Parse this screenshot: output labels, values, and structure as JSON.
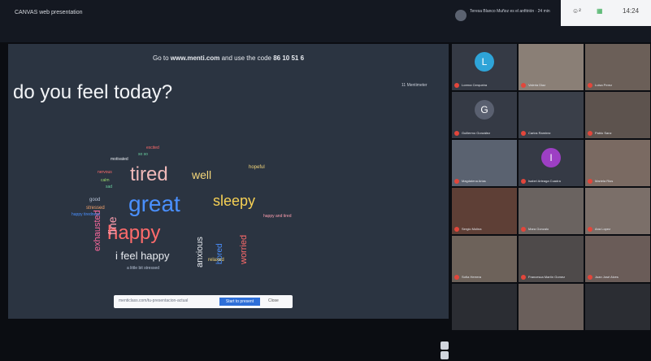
{
  "window": {
    "title": "CANVAS web presentation"
  },
  "host": {
    "label": "Teresa Blanco Muñoz es el anfitrión · 24 min"
  },
  "controls": {
    "participants": "☺²",
    "grid": "▦",
    "time": "14:24"
  },
  "slide": {
    "instruction_prefix": "Go to ",
    "instruction_site": "www.menti.com",
    "instruction_mid": " and use the code ",
    "instruction_code": "86 10 51 6",
    "question": "do you feel today?",
    "votes": "11 Mentimeter",
    "share_bar": {
      "input": "menticlass.com/tu-presentacion-actual",
      "button": "Start to present",
      "close": "Close"
    }
  },
  "words": [
    {
      "text": "great",
      "color": "#4a90ff"
    },
    {
      "text": "tired",
      "color": "#f0b9b9"
    },
    {
      "text": "happy",
      "color": "#ff6b6b"
    },
    {
      "text": "sleepy",
      "color": "#f7d154"
    },
    {
      "text": "well",
      "color": "#f5d77a"
    },
    {
      "text": "i feel happy",
      "color": "#e8ebf0"
    },
    {
      "text": "fine",
      "color": "#ff9fb0"
    },
    {
      "text": "exhausted",
      "color": "#ff6aa0"
    },
    {
      "text": "anxious",
      "color": "#e8ebf0"
    },
    {
      "text": "bored",
      "color": "#4a90ff"
    },
    {
      "text": "worried",
      "color": "#ff6b6b"
    },
    {
      "text": "relaxed",
      "color": "#f5d77a"
    },
    {
      "text": "happy and tired",
      "color": "#ff9fb0"
    },
    {
      "text": "good",
      "color": "#b7c3d6"
    },
    {
      "text": "stressed",
      "color": "#f5a36a"
    },
    {
      "text": "sad",
      "color": "#6ad0a0"
    },
    {
      "text": "calm",
      "color": "#9bd86b"
    },
    {
      "text": "motivated",
      "color": "#e8ebf0"
    },
    {
      "text": "excited",
      "color": "#ff6b6b"
    },
    {
      "text": "so so",
      "color": "#6ad0a0"
    },
    {
      "text": "a little bit stressed",
      "color": "#b7c3d6"
    },
    {
      "text": "happy tiredness",
      "color": "#4a90ff"
    },
    {
      "text": "nervous",
      "color": "#ff6b6b"
    },
    {
      "text": "hopeful",
      "color": "#f5d77a"
    }
  ],
  "participants": [
    {
      "name": "Lorena Cerqueira",
      "initial": "L",
      "bg": "#353a45",
      "avatar": "#2ea4d8"
    },
    {
      "name": "Valeria Diaz",
      "initial": "",
      "bg": "#8a7f76",
      "avatar": ""
    },
    {
      "name": "Luisa Perez",
      "initial": "",
      "bg": "#6b5f58",
      "avatar": ""
    },
    {
      "name": "Guillermo González",
      "initial": "G",
      "bg": "#353a45",
      "avatar": "#5a6070"
    },
    {
      "name": "Carlos Ramirez",
      "initial": "",
      "bg": "#3a3f49",
      "avatar": ""
    },
    {
      "name": "Pablo Sanz",
      "initial": "",
      "bg": "#5d534e",
      "avatar": ""
    },
    {
      "name": "Magdalena Arias",
      "initial": "",
      "bg": "#5a6270",
      "avatar": ""
    },
    {
      "name": "Isabel Arteaga Cuadra",
      "initial": "I",
      "bg": "#353a45",
      "avatar": "#9d3fc4"
    },
    {
      "name": "Mariela Rios",
      "initial": "",
      "bg": "#7a6a62",
      "avatar": ""
    },
    {
      "name": "Sergio Molina",
      "initial": "",
      "bg": "#5e3f36",
      "avatar": ""
    },
    {
      "name": "Mara Gonzalo",
      "initial": "",
      "bg": "#6a6360",
      "avatar": ""
    },
    {
      "name": "Ana Lopez",
      "initial": "",
      "bg": "#7b6f69",
      "avatar": ""
    },
    {
      "name": "Sofía Herrera",
      "initial": "",
      "bg": "#6d625a",
      "avatar": ""
    },
    {
      "name": "Francesca Martín Gomez",
      "initial": "",
      "bg": "#4e4a4a",
      "avatar": ""
    },
    {
      "name": "Juan José Alves",
      "initial": "",
      "bg": "#6a5c58",
      "avatar": ""
    },
    {
      "name": "",
      "initial": "",
      "bg": "#2b2d33",
      "avatar": ""
    },
    {
      "name": "",
      "initial": "",
      "bg": "#6a5f5b",
      "avatar": ""
    },
    {
      "name": "",
      "initial": "",
      "bg": "#2b2d33",
      "avatar": ""
    }
  ]
}
